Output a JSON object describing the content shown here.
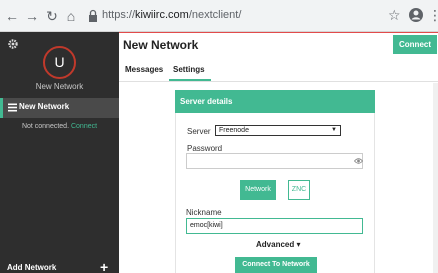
{
  "browser": {
    "back_icon": "arrow-left-icon",
    "forward_icon": "arrow-right-icon",
    "reload_icon": "reload-icon",
    "home_icon": "home-icon",
    "url_scheme": "https://",
    "url_host": "kiwiirc.com",
    "url_path": "/nextclient/"
  },
  "sidebar": {
    "avatar_initial": "U",
    "network_name": "New Network",
    "network_item_label": "New Network",
    "status_text": "Not connected.",
    "status_link": "Connect",
    "add_network_label": "Add Network",
    "add_icon": "+"
  },
  "header": {
    "title": "New Network",
    "connect_label": "Connect"
  },
  "tabs": [
    {
      "label": "Messages"
    },
    {
      "label": "Settings"
    }
  ],
  "server_details": {
    "title": "Server details",
    "server_label": "Server",
    "server_value": "Freenode",
    "password_label": "Password",
    "password_value": "",
    "network_tab_label": "Network",
    "znc_tab_label": "ZNC",
    "nickname_label": "Nickname",
    "nickname_value": "emoc[kiwi]",
    "advanced_label": "Advanced ▾",
    "connect_network_label": "Connect To Network"
  },
  "colors": {
    "accent": "#42b992",
    "sidebar_bg": "#2e2e2e",
    "avatar_ring": "#c0392b",
    "top_line": "#e24b4b"
  }
}
